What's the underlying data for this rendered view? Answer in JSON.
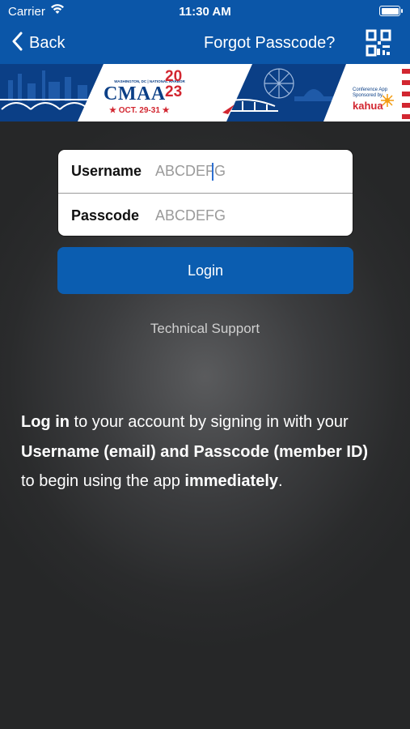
{
  "status": {
    "carrier": "Carrier",
    "time": "11:30 AM"
  },
  "nav": {
    "back_label": "Back",
    "forgot_label": "Forgot Passcode?"
  },
  "banner": {
    "location": "WASHINGTON, DC | NATIONAL HARBOR",
    "title": "CMAA",
    "year_top": "20",
    "year_bottom": "23",
    "dates": "★ OCT. 29-31 ★",
    "sponsor_line1": "Conference App",
    "sponsor_line2": "Sponsored by",
    "sponsor_name": "kahua",
    "colors": {
      "navy": "#0b3f86",
      "red": "#d22630",
      "white": "#ffffff"
    }
  },
  "form": {
    "username_label": "Username",
    "username_placeholder": "ABCDEFG",
    "passcode_label": "Passcode",
    "passcode_placeholder": "ABCDEFG"
  },
  "login_label": "Login",
  "support_label": "Technical Support",
  "info": {
    "p1_bold": "Log in",
    "p1_text": " to your account by signing in with your ",
    "p2_bold": "Username (email) and Passcode (member ID)",
    "p2_text": " to begin using the app ",
    "p3_bold": "immediately",
    "p3_text": "."
  },
  "colors": {
    "nav_blue": "#0b56a8",
    "button_blue": "#0b5db0"
  }
}
